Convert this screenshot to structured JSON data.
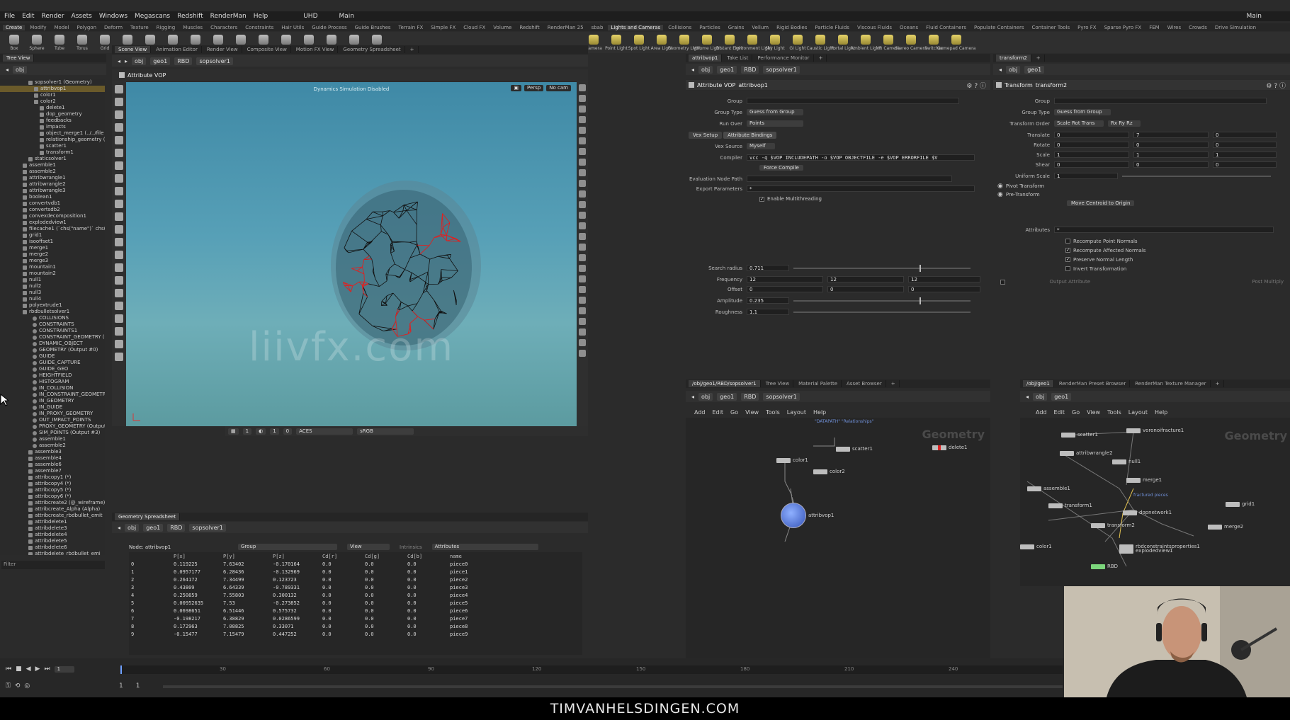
{
  "menu": [
    "File",
    "Edit",
    "Render",
    "Assets",
    "Windows",
    "Megascans",
    "Redshift",
    "RenderMan",
    "Help"
  ],
  "menu_right": [
    "UHD",
    "Main"
  ],
  "shelf_tabs": [
    "Create",
    "Modify",
    "Model",
    "Polygon",
    "Deform",
    "Texture",
    "Rigging",
    "Muscles",
    "Characters",
    "Constraints",
    "Hair Utils",
    "Guide Process",
    "Guide Brushes",
    "Terrain FX",
    "Simple FX",
    "Cloud FX",
    "Volume",
    "Redshift",
    "RenderMan 25",
    "sbab",
    "Lights and Cameras",
    "Collisions",
    "Particles",
    "Grains",
    "Vellum",
    "Rigid Bodies",
    "Particle Fluids",
    "Viscous Fluids",
    "Oceans",
    "Fluid Containers",
    "Populate Containers",
    "Container Tools",
    "Pyro FX",
    "Sparse Pyro FX",
    "FEM",
    "Wires",
    "Crowds",
    "Drive Simulation"
  ],
  "shelf_tools_left": [
    "Box",
    "Sphere",
    "Tube",
    "Torus",
    "Grid",
    "Null",
    "Line",
    "Circle",
    "Curve",
    "Draw Curve",
    "Path",
    "Spray Paint",
    "Font",
    "Platonic Solids",
    "L-System",
    "Metaball",
    "File"
  ],
  "shelf_tools_right": [
    "Camera",
    "Point Light",
    "Spot Light",
    "Area Light",
    "Geometry Light",
    "Volume Light",
    "Distant Light",
    "Environment Light",
    "Sky Light",
    "GI Light",
    "Caustic Light",
    "Portal Light",
    "Ambient Light",
    "VR Camera",
    "Stereo Camera",
    "Switcher",
    "Gamepad Camera"
  ],
  "tree": {
    "tabs": [
      "Tree View"
    ],
    "path": "obj",
    "filter_label": "Filter",
    "nodes": [
      "sopsolver1 (Geometry)",
      "attribvop1",
      "color1",
      "color2",
      "delete1",
      "dop_geometry",
      "feedbacks",
      "impacts",
      "object_merge1 (../../file",
      "relationship_geometry (",
      "scatter1",
      "transform1",
      "staticsolver1",
      "assemble1",
      "assemble2",
      "attribwrangle1",
      "attribwrangle2",
      "attribwrangle3",
      "boolean1",
      "convertvdb1",
      "convertsdb2",
      "convexdecomposition1",
      "explodedview1",
      "filecache1 (`chs(\"name\")` chs(",
      "grid1",
      "isooffset1",
      "merge1",
      "merge2",
      "merge3",
      "mountain1",
      "mountain2",
      "null1",
      "null2",
      "null3",
      "null4",
      "polyextrude1",
      "rbdbulletsolver1",
      "COLLISIONS",
      "CONSTRAINTS",
      "CONSTRAINTS1",
      "CONSTRAINT_GEOMETRY (0",
      "DYNAMIC_OBJECT",
      "GEOMETRY (Output #0)",
      "GUIDE",
      "GUIDE_CAPTURE",
      "GUIDE_GEO",
      "HEIGHTFIELD",
      "HISTOGRAM",
      "IN_COLLISION",
      "IN_CONSTRAINT_GEOMETRY",
      "IN_GEOMETRY",
      "IN_GUIDE",
      "IN_PROXY_GEOMETRY",
      "OUT_IMPACT_POINTS",
      "PROXY_GEOMETRY (Output #",
      "SIM_POINTS (Output #3)",
      "assemble1",
      "assemble2",
      "assemble3",
      "assemble4",
      "assemble6",
      "assemble7",
      "attribcopy1 (*)",
      "attribcopy4 (*)",
      "attribcopy5 (*)",
      "attribcopy6 (*)",
      "attribcreate2 (@_wireframe)",
      "attribcreate_Alpha (Alpha)",
      "attribcreate_rbdbullet_emit",
      "attribdelete1",
      "attribdelete3",
      "attribdelete4",
      "attribdelete5",
      "attribdelete6",
      "attribdelete_rbdbullet_emi"
    ]
  },
  "viewport": {
    "tabs": [
      "Scene View",
      "Animation Editor",
      "Render View",
      "Composite View",
      "Motion FX View",
      "Geometry Spreadsheet"
    ],
    "path": [
      "obj",
      "geo1",
      "RBD",
      "sopsolver1"
    ],
    "title": "Attribute VOP",
    "status": "Dynamics Simulation Disabled",
    "persp": "Persp",
    "cam": "No cam",
    "bottom_vals": [
      "1",
      "1",
      "0"
    ],
    "colorspace": "ACES",
    "display": "sRGB",
    "watermark": "liivfx.com"
  },
  "spreadsheet": {
    "tab": "Geometry Spreadsheet",
    "path": [
      "obj",
      "geo1",
      "RBD",
      "sopsolver1"
    ],
    "node_label": "Node: attribvop1",
    "group_label": "Group",
    "view_label": "View",
    "intrinsics_label": "Intrinsics",
    "attributes_label": "Attributes",
    "columns": [
      "",
      "P[x]",
      "P[y]",
      "P[z]",
      "Cd[r]",
      "Cd[g]",
      "Cd[b]",
      "name"
    ],
    "rows": [
      [
        "0",
        "0.119225",
        "7.63402",
        "-0.170164",
        "0.0",
        "0.0",
        "0.0",
        "piece0"
      ],
      [
        "1",
        "0.0957177",
        "6.28436",
        "-0.132969",
        "0.0",
        "0.0",
        "0.0",
        "piece1"
      ],
      [
        "2",
        "0.264172",
        "7.34499",
        "0.123723",
        "0.0",
        "0.0",
        "0.0",
        "piece2"
      ],
      [
        "3",
        "0.43809",
        "6.64339",
        "-0.789331",
        "0.0",
        "0.0",
        "0.0",
        "piece3"
      ],
      [
        "4",
        "0.250859",
        "7.55803",
        "0.300132",
        "0.0",
        "0.0",
        "0.0",
        "piece4"
      ],
      [
        "5",
        "0.00952635",
        "7.53",
        "-0.273852",
        "0.0",
        "0.0",
        "0.0",
        "piece5"
      ],
      [
        "6",
        "0.0698651",
        "6.51446",
        "0.575732",
        "0.0",
        "0.0",
        "0.0",
        "piece6"
      ],
      [
        "7",
        "-0.198217",
        "6.38829",
        "0.0286599",
        "0.0",
        "0.0",
        "0.0",
        "piece7"
      ],
      [
        "8",
        "0.172963",
        "7.08825",
        "0.33071",
        "0.0",
        "0.0",
        "0.0",
        "piece8"
      ],
      [
        "9",
        "-0.15477",
        "7.15479",
        "0.447252",
        "0.0",
        "0.0",
        "0.0",
        "piece9"
      ]
    ]
  },
  "vop": {
    "tabs": [
      "attribvop1",
      "Take List",
      "Performance Monitor"
    ],
    "path": [
      "obj",
      "geo1",
      "RBD",
      "sopsolver1"
    ],
    "type": "Attribute VOP",
    "name": "attribvop1",
    "group_label": "Group",
    "group_type_label": "Group Type",
    "group_type": "Guess from Group",
    "run_over_label": "Run Over",
    "run_over": "Points",
    "subtabs": [
      "Vex Setup",
      "Attribute Bindings"
    ],
    "vex_source_label": "Vex Source",
    "vex_source": "Myself",
    "compiler_label": "Compiler",
    "compiler": "vcc -q $VOP_INCLUDEPATH -o $VOP_OBJECTFILE -e $VOP_ERRORFILE $V",
    "force_compile": "Force Compile",
    "eval_path_label": "Evaluation Node Path",
    "export_params_label": "Export Parameters",
    "export_params": "*",
    "multithreading": "Enable Multithreading",
    "search_radius_label": "Search radius",
    "search_radius": "0.711",
    "search_radius_level": 0.71,
    "frequency_label": "Frequency",
    "frequency": [
      "12",
      "12",
      "12"
    ],
    "offset_label": "Offset",
    "offset": [
      "0",
      "0",
      "0"
    ],
    "amplitude_label": "Amplitude",
    "amplitude": "0.235",
    "amplitude_level": 0.71,
    "roughness_label": "Roughness",
    "roughness": "1.1"
  },
  "transform": {
    "tabs": [
      "transform2"
    ],
    "path": [
      "obj",
      "geo1"
    ],
    "type": "Transform",
    "name": "transform2",
    "group_label": "Group",
    "group_type_label": "Group Type",
    "group_type": "Guess from Group",
    "order_label": "Transform Order",
    "order1": "Scale Rot Trans",
    "order2": "Rx Ry Rz",
    "translate_label": "Translate",
    "translate": [
      "0",
      "7",
      "0"
    ],
    "rotate_label": "Rotate",
    "rotate": [
      "0",
      "0",
      "0"
    ],
    "scale_label": "Scale",
    "scale": [
      "1",
      "1",
      "1"
    ],
    "shear_label": "Shear",
    "shear": [
      "0",
      "0",
      "0"
    ],
    "uniform_label": "Uniform Scale",
    "uniform": "1",
    "pivot": "Pivot Transform",
    "pretransform": "Pre-Transform",
    "move_centroid": "Move Centroid to Origin",
    "attributes_label": "Attributes",
    "attributes": "*",
    "checks": [
      {
        "label": "Recompute Point Normals",
        "on": false
      },
      {
        "label": "Recompute Affected Normals",
        "on": true
      },
      {
        "label": "Preserve Normal Length",
        "on": true
      },
      {
        "label": "Invert Transformation",
        "on": false
      }
    ],
    "output_attr": "Output Attribute",
    "post_multiply": "Post Multiply"
  },
  "network1": {
    "tabs": [
      "/obj/geo1/RBD/sopsolver1",
      "Tree View",
      "Material Palette",
      "Asset Browser"
    ],
    "path": [
      "obj",
      "geo1",
      "RBD",
      "sopsolver1"
    ],
    "menu": [
      "Add",
      "Edit",
      "Go",
      "View",
      "Tools",
      "Layout",
      "Help"
    ],
    "context": "Geometry",
    "nodes": [
      "scatter1",
      "delete1",
      "color1",
      "color2",
      "attribvop1"
    ],
    "note": "\"DATAPATH\" \"Relationships\""
  },
  "network2": {
    "tabs": [
      "/obj/geo1",
      "RenderMan Preset Browser",
      "RenderMan Texture Manager"
    ],
    "path": [
      "obj",
      "geo1"
    ],
    "menu": [
      "Add",
      "Edit",
      "Go",
      "View",
      "Tools",
      "Layout",
      "Help"
    ],
    "context": "Geometry",
    "nodes": [
      "scatter1",
      "voronoifracture1",
      "attribwrangle2",
      "null1",
      "merge1",
      "assemble1",
      "transform1",
      "dopnetwork1",
      "transform2",
      "rbdconstraintsproperties1",
      "explodedview1",
      "grid1",
      "merge2",
      "RBD",
      "color1"
    ],
    "fracture_note": "fractured pieces"
  },
  "timeline": {
    "frame": "1",
    "start": "1",
    "end": "1",
    "ticks": [
      "30",
      "60",
      "90",
      "120",
      "150",
      "180",
      "210",
      "240"
    ]
  },
  "caption": "TIMVANHELSDINGEN.COM"
}
